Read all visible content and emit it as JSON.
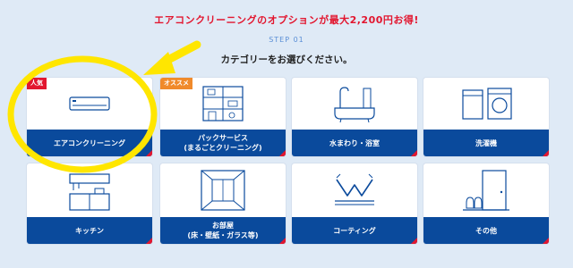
{
  "header": {
    "promo": "エアコンクリーニングのオプションが最大2,200円お得!",
    "step": "STEP 01",
    "title": "カテゴリーをお選びください。"
  },
  "categories": [
    {
      "line1": "エアコンクリーニング",
      "line2": "",
      "badge": "人気",
      "icon": "air-conditioner-icon"
    },
    {
      "line1": "パックサービス",
      "line2": "(まるごとクリーニング)",
      "badge": "オススメ",
      "icon": "house-icon"
    },
    {
      "line1": "水まわり・浴室",
      "line2": "",
      "badge": "",
      "icon": "bathtub-icon"
    },
    {
      "line1": "洗濯機",
      "line2": "",
      "badge": "",
      "icon": "washing-machine-icon"
    },
    {
      "line1": "キッチン",
      "line2": "",
      "badge": "",
      "icon": "kitchen-icon"
    },
    {
      "line1": "お部屋",
      "line2": "(床・壁紙・ガラス等)",
      "badge": "",
      "icon": "room-icon"
    },
    {
      "line1": "コーティング",
      "line2": "",
      "badge": "",
      "icon": "coating-icon"
    },
    {
      "line1": "その他",
      "line2": "",
      "badge": "",
      "icon": "entrance-icon"
    }
  ],
  "colors": {
    "background": "#dfeaf6",
    "label_bg": "#0a4a9c",
    "accent_red": "#e2162f",
    "badge_orange": "#f08a2b",
    "highlight_yellow": "#ffe600"
  }
}
